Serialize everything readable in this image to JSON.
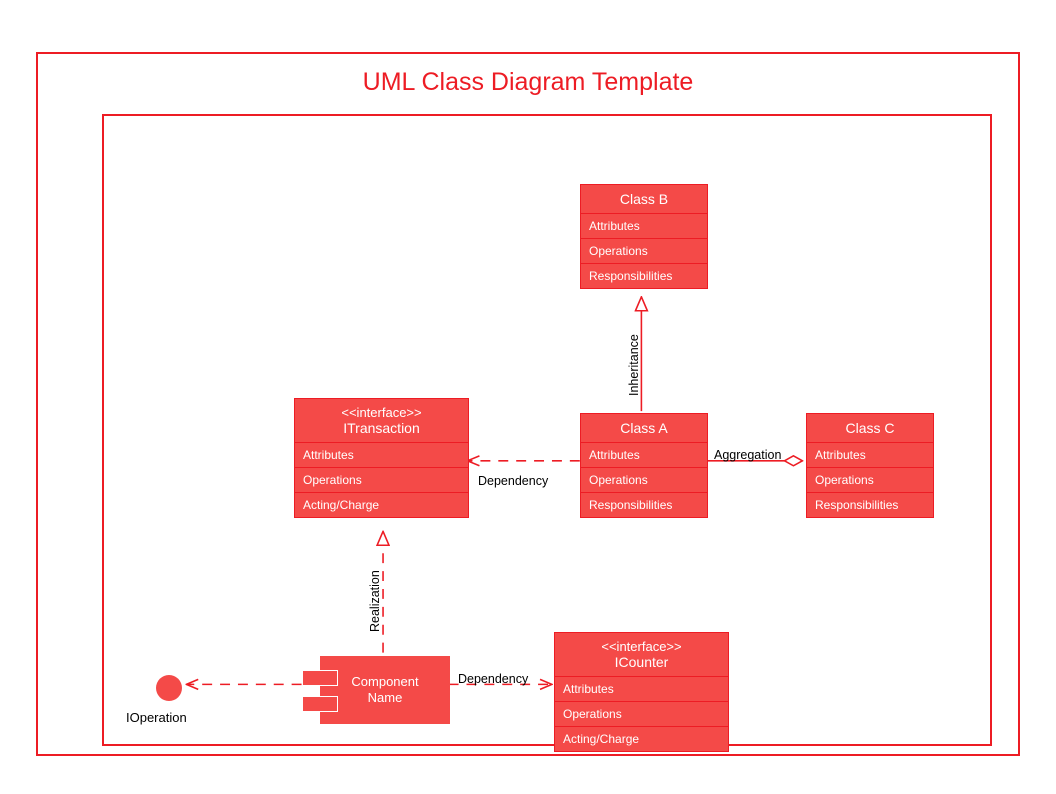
{
  "title": "UML Class Diagram Template",
  "nodes": {
    "classB": {
      "name": "Class B",
      "rows": [
        "Attributes",
        "Operations",
        "Responsibilities"
      ]
    },
    "classA": {
      "name": "Class A",
      "rows": [
        "Attributes",
        "Operations",
        "Responsibilities"
      ]
    },
    "classC": {
      "name": "Class C",
      "rows": [
        "Attributes",
        "Operations",
        "Responsibilities"
      ]
    },
    "iTransaction": {
      "stereotype": "<<interface>>",
      "name": "ITransaction",
      "rows": [
        "Attributes",
        "Operations",
        "Acting/Charge"
      ]
    },
    "iCounter": {
      "stereotype": "<<interface>>",
      "name": "ICounter",
      "rows": [
        "Attributes",
        "Operations",
        "Acting/Charge"
      ]
    },
    "component": {
      "name": "Component\nName"
    },
    "iOperation": {
      "name": "IOperation"
    }
  },
  "relations": {
    "inheritance": "Inheritance",
    "dependency1": "Dependency",
    "aggregation": "Aggregation",
    "realization": "Realization",
    "dependency2": "Dependency"
  },
  "colors": {
    "stroke": "#ed1c24",
    "fill": "#f44a48"
  }
}
